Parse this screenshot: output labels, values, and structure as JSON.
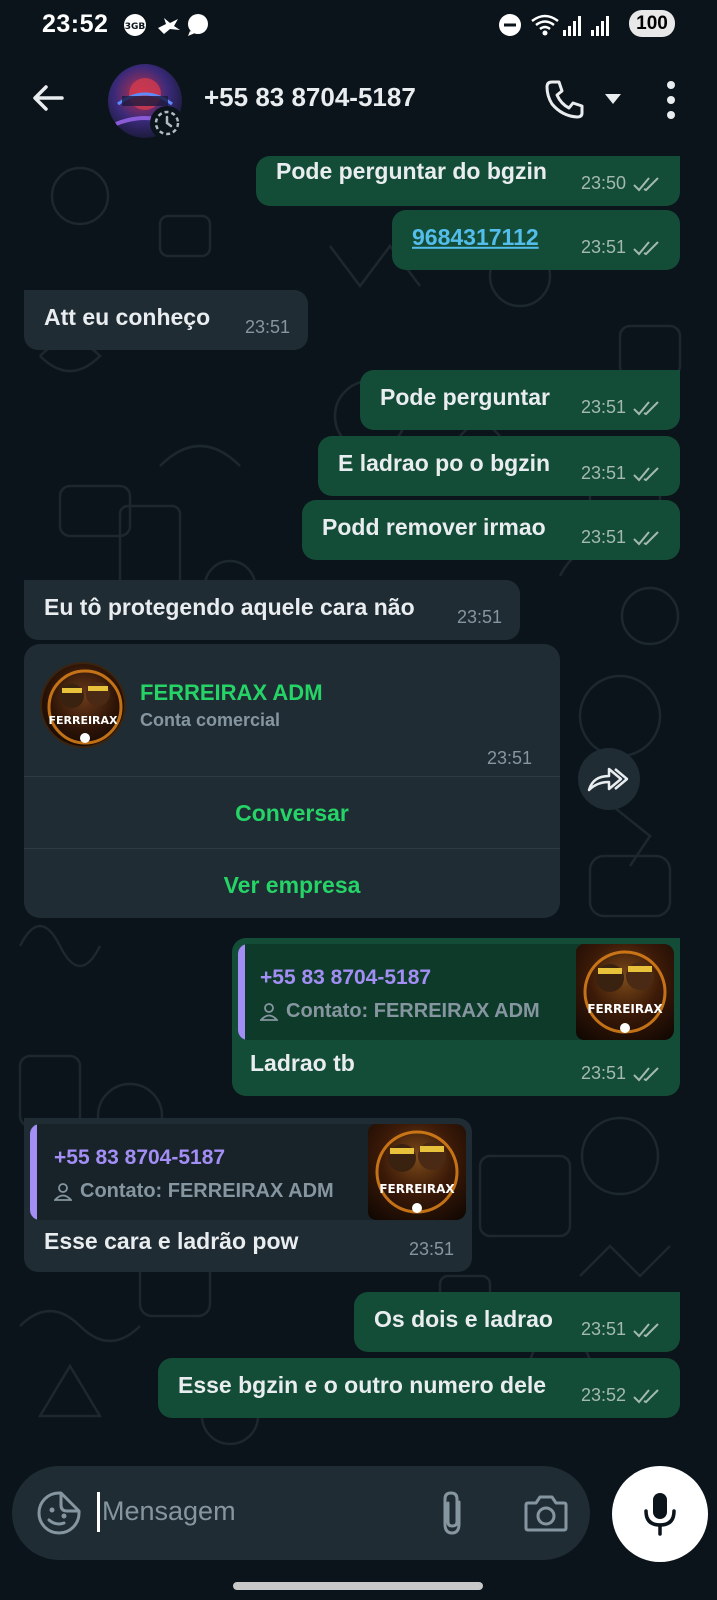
{
  "status_bar": {
    "time": "23:52",
    "battery": "100",
    "notification_icons": [
      "vpn-badge-icon",
      "bird-icon",
      "chat-bubble-icon"
    ],
    "right_icons": [
      "do-not-disturb-icon",
      "wifi-icon",
      "signal-icon",
      "signal-icon"
    ]
  },
  "header": {
    "contact": "+55 83 8704-5187",
    "icons": [
      "back-arrow-icon",
      "phone-icon",
      "chevron-down-icon",
      "more-vert-icon"
    ]
  },
  "messages": [
    {
      "dir": "out",
      "text": "Pode perguntar do bgzin",
      "time": "23:50"
    },
    {
      "dir": "out",
      "text": "9684317112",
      "time": "23:51",
      "link": true
    },
    {
      "dir": "in",
      "text": "Att eu conheço",
      "time": "23:51"
    },
    {
      "dir": "out",
      "text": "Pode perguntar",
      "time": "23:51"
    },
    {
      "dir": "out",
      "text": "E ladrao po o bgzin",
      "time": "23:51"
    },
    {
      "dir": "out",
      "text": "Podd remover irmao",
      "time": "23:51"
    },
    {
      "dir": "in",
      "text": "Eu tô protegendo aquele cara não",
      "time": "23:51"
    }
  ],
  "business_card": {
    "name": "FERREIRAX ADM",
    "subtitle": "Conta comercial",
    "time": "23:51",
    "buttons": [
      "Conversar",
      "Ver empresa"
    ],
    "avatar_text": "FERREIRAX"
  },
  "contact_reply_out": {
    "number": "+55 83 8704-5187",
    "contact_label": "Contato: FERREIRAX ADM",
    "thumb_text": "FERREIRAX",
    "text": "Ladrao tb",
    "time": "23:51"
  },
  "contact_reply_in": {
    "number": "+55 83 8704-5187",
    "contact_label": "Contato: FERREIRAX ADM",
    "thumb_text": "FERREIRAX",
    "text": "Esse cara e ladrão pow",
    "time": "23:51"
  },
  "final_messages": [
    {
      "dir": "out",
      "text": "Os dois e ladrao",
      "time": "23:51"
    },
    {
      "dir": "out",
      "text": "Esse bgzin e o outro numero dele",
      "time": "23:52"
    }
  ],
  "input": {
    "placeholder": "Mensagem",
    "icons": [
      "sticker-icon",
      "paperclip-icon",
      "camera-icon",
      "mic-icon"
    ]
  },
  "colors": {
    "background": "#0b141a",
    "outgoing_bubble": "#144d37",
    "incoming_bubble": "#1f2c34",
    "accent_green": "#25d366",
    "quote_purple": "#a38ef5",
    "link_blue": "#53bdeb"
  }
}
